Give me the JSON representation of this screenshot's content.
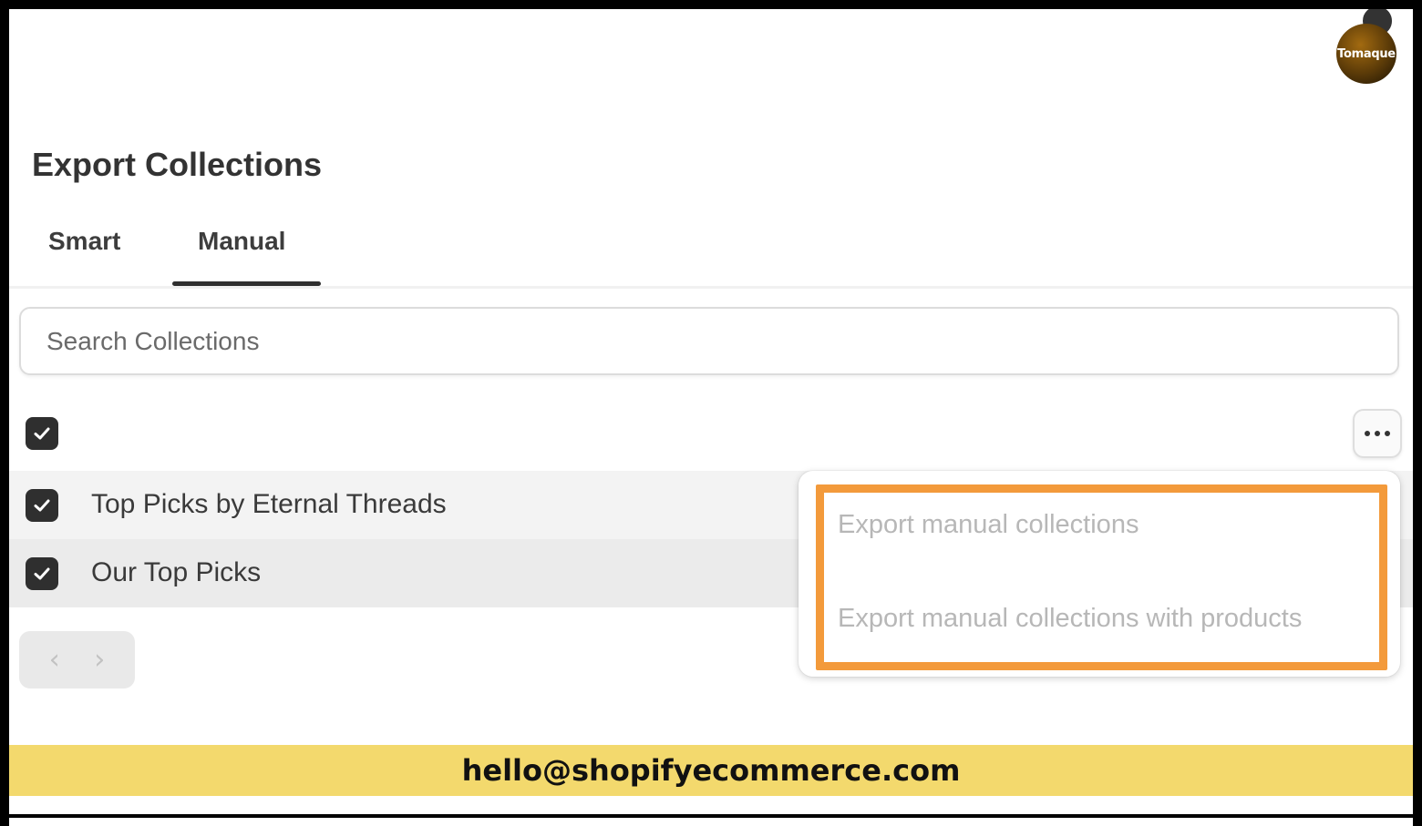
{
  "brand": {
    "logo_text": "Tomaque"
  },
  "page": {
    "title": "Export Collections"
  },
  "tabs": [
    {
      "label": "Smart",
      "active": false
    },
    {
      "label": "Manual",
      "active": true
    }
  ],
  "search": {
    "placeholder": "Search Collections",
    "value": ""
  },
  "list": {
    "select_all_checked": true,
    "rows": [
      {
        "label": "Top Picks by Eternal Threads",
        "checked": true
      },
      {
        "label": "Our Top Picks",
        "checked": true
      }
    ]
  },
  "actions": {
    "more_icon": "more-horizontal-icon",
    "menu_items": [
      {
        "label": "Export manual collections"
      },
      {
        "label": "Export manual collections with products"
      }
    ],
    "highlight_color": "#f39a3b"
  },
  "pagination": {
    "prev_glyph": "‹",
    "next_glyph": "›"
  },
  "footer": {
    "email": "hello@shopifyecommerce.com",
    "band_color": "#f3d96d"
  }
}
